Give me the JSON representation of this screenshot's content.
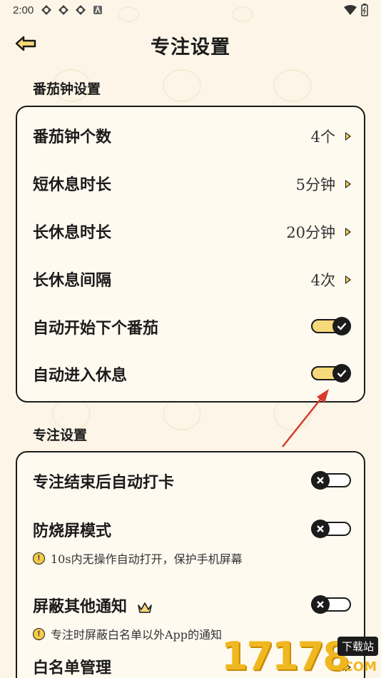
{
  "status_bar": {
    "time": "2:00",
    "colors": {
      "icon": "#333333"
    }
  },
  "header": {
    "title": "专注设置"
  },
  "pomodoro_section": {
    "title": "番茄钟设置",
    "rows": [
      {
        "label": "番茄钟个数",
        "value": "4个"
      },
      {
        "label": "短休息时长",
        "value": "5分钟"
      },
      {
        "label": "长休息时长",
        "value": "20分钟"
      },
      {
        "label": "长休息间隔",
        "value": "4次"
      }
    ],
    "toggles": [
      {
        "label": "自动开始下个番茄",
        "state": "on"
      },
      {
        "label": "自动进入休息",
        "state": "on"
      }
    ]
  },
  "focus_section": {
    "title": "专注设置",
    "items": [
      {
        "label": "专注结束后自动打卡",
        "state": "off"
      },
      {
        "label": "防烧屏模式",
        "state": "off",
        "hint": "10s内无操作自动打开，保护手机屏幕"
      },
      {
        "label": "屏蔽其他通知",
        "state": "off",
        "hint": "专注时屏蔽白名单以外App的通知",
        "icon": "crown-icon"
      },
      {
        "label": "白名单管理"
      }
    ]
  },
  "watermark": {
    "number": "17178",
    "badge": "下载站",
    "suffix": ".COM"
  },
  "colors": {
    "accent": "#f7d97a",
    "background": "#fdf6e8",
    "annotation_arrow": "#d63a2f"
  }
}
